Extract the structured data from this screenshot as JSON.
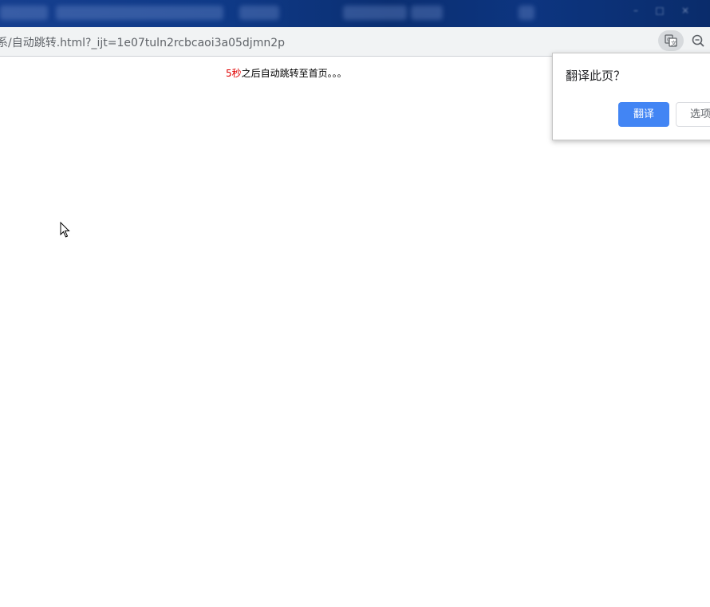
{
  "browser": {
    "url": "系/自动跳转.html?_ijt=1e07tuln2rcbcaoi3a05djmn2p",
    "translate_icon": "translate-icon",
    "zoom_icon": "zoom-icon"
  },
  "page": {
    "countdown": "5秒",
    "message": "之后自动跳转至首页。。。"
  },
  "translate_popup": {
    "title": "翻译此页？",
    "translate_label": "翻译",
    "options_label": "选项",
    "accent_color": "#4285f4"
  },
  "cursor_icon": "mouse-pointer-icon"
}
